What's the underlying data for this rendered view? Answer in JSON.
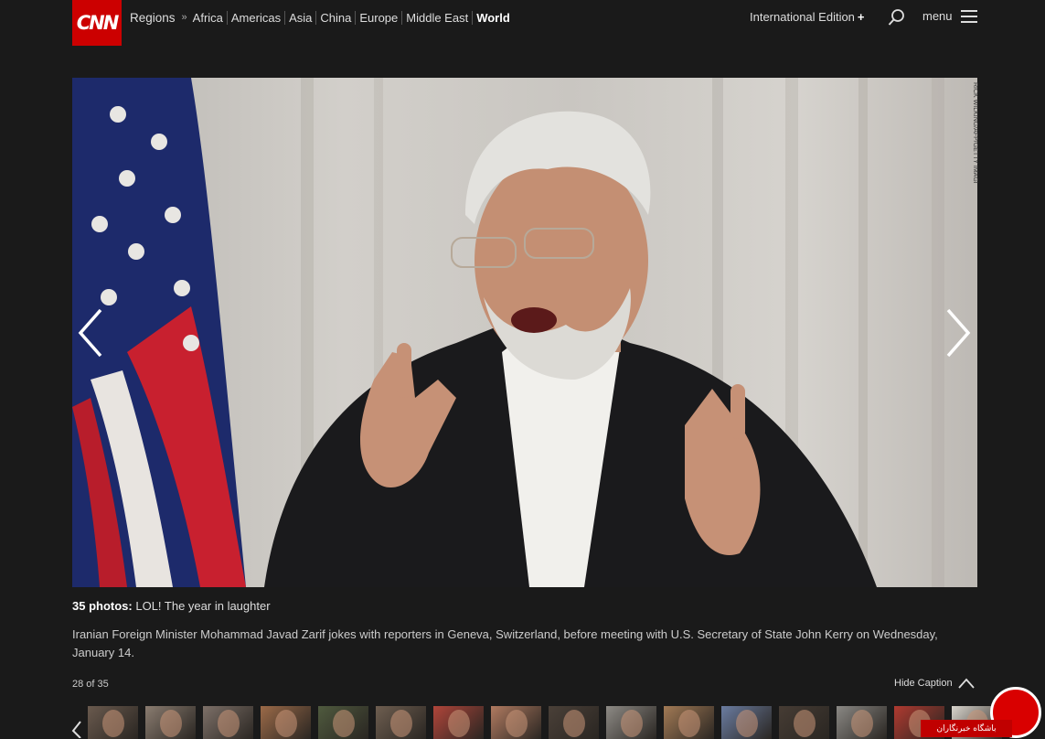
{
  "header": {
    "logo_text": "CNN",
    "regions_label": "Regions",
    "regions_separator": "»",
    "regions": [
      {
        "label": "Africa",
        "active": false
      },
      {
        "label": "Americas",
        "active": false
      },
      {
        "label": "Asia",
        "active": false
      },
      {
        "label": "China",
        "active": false
      },
      {
        "label": "Europe",
        "active": false
      },
      {
        "label": "Middle East",
        "active": false
      },
      {
        "label": "World",
        "active": true
      }
    ],
    "edition_label": "International Edition",
    "edition_symbol": "+",
    "menu_label": "menu",
    "search_icon": "search-icon",
    "menu_icon": "hamburger-icon"
  },
  "gallery": {
    "photo_credit": "RICK WILKING/AFP/GETTY IMAGES",
    "title_count": "35 photos:",
    "title_text": "LOL! The year in laughter",
    "caption": "Iranian Foreign Minister Mohammad Javad Zarif jokes with reporters in Geneva, Switzerland, before meeting with U.S. Secretary of State John Kerry on Wednesday, January 14.",
    "counter": "28 of 35",
    "hide_caption_label": "Hide Caption",
    "prev_icon": "chevron-left-icon",
    "next_icon": "chevron-right-icon"
  },
  "thumbnails": {
    "colors": [
      "#6a5a4e",
      "#8a7c70",
      "#7d7068",
      "#9b6a48",
      "#4f5a3e",
      "#6e5e50",
      "#b0453a",
      "#b07a60",
      "#4a4038",
      "#8d8a85",
      "#a27a55",
      "#6a7ca0",
      "#463c34",
      "#8a8884",
      "#b03a30",
      "#d8d4cc"
    ]
  },
  "watermark": {
    "text": "باشگاه خبرنگاران"
  },
  "colors": {
    "brand_red": "#cc0000",
    "background": "#1a1a1a"
  }
}
